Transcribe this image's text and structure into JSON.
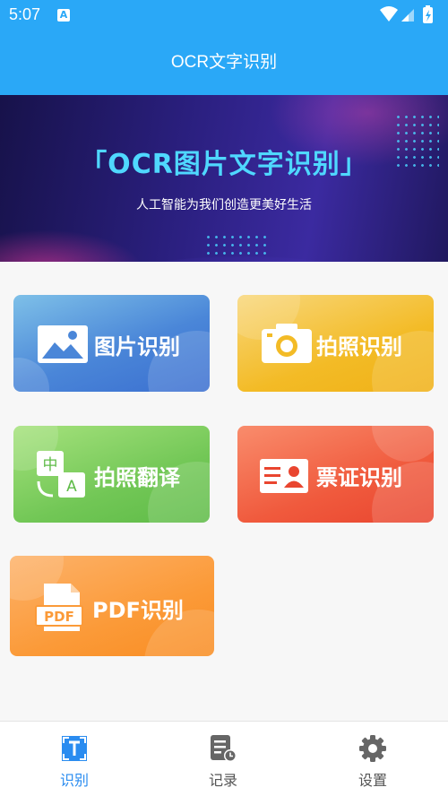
{
  "status_bar": {
    "time": "5:07",
    "notification_icon": "A"
  },
  "app_bar": {
    "title": "OCR文字识别"
  },
  "banner": {
    "title": "「OCR图片文字识别」",
    "subtitle": "人工智能为我们创造更美好生活"
  },
  "features": [
    {
      "label": "图片识别",
      "icon": "image-icon",
      "color": "#4a86d8"
    },
    {
      "label": "拍照识别",
      "icon": "camera-icon",
      "color": "#f3bb26"
    },
    {
      "label": "拍照翻译",
      "icon": "translate-icon",
      "icon_text_top": "中",
      "icon_text_bottom": "A",
      "color": "#72c756"
    },
    {
      "label": "票证识别",
      "icon": "id-card-icon",
      "color": "#f05a3d"
    },
    {
      "label": "PDF识别",
      "icon": "pdf-icon",
      "icon_text": "PDF",
      "color": "#fb9a38"
    }
  ],
  "tabs": [
    {
      "label": "识别",
      "icon": "ocr-scan-icon",
      "active": true
    },
    {
      "label": "记录",
      "icon": "history-icon",
      "active": false
    },
    {
      "label": "设置",
      "icon": "settings-icon",
      "active": false
    }
  ],
  "colors": {
    "primary": "#2aa8f7",
    "tab_active": "#2a8cf0",
    "tab_inactive": "#555555"
  }
}
